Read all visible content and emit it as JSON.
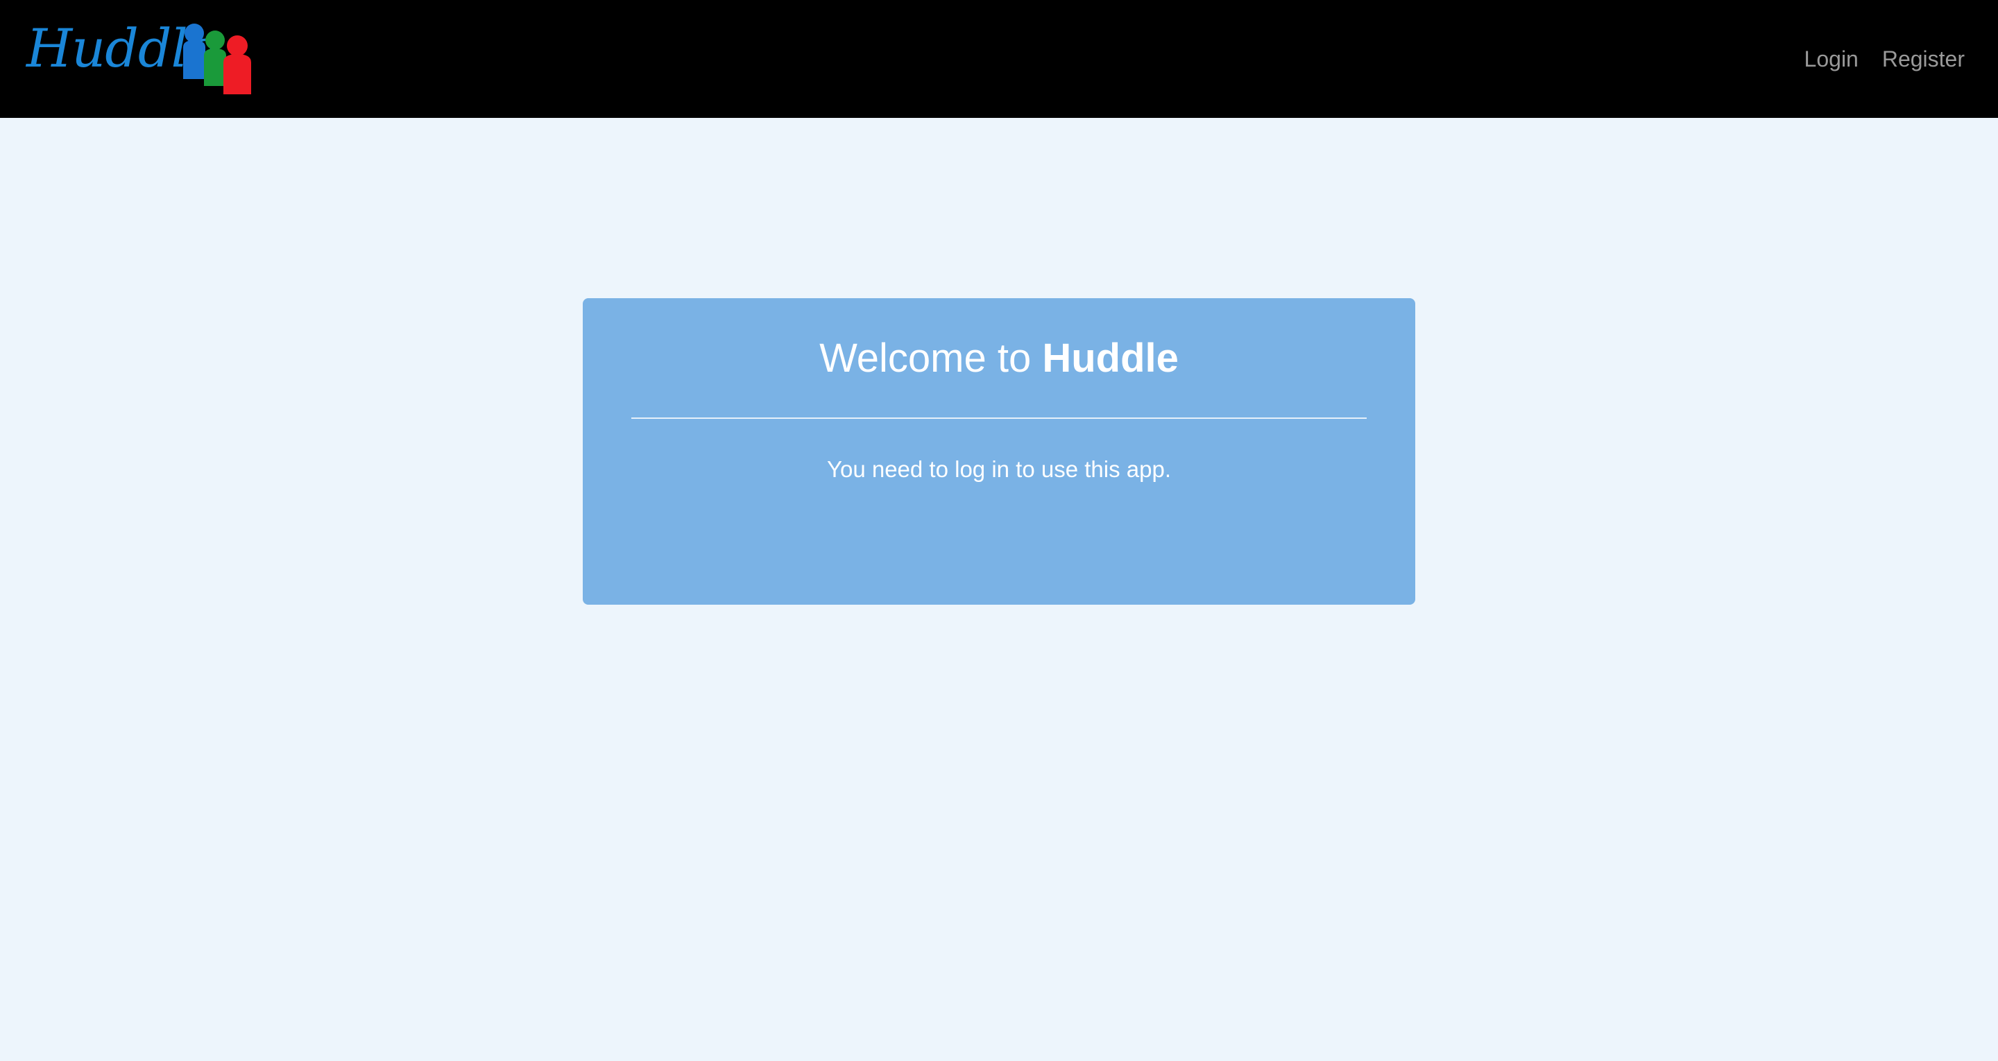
{
  "brand": {
    "name": "Huddle",
    "colors": {
      "text": "#1a86d8",
      "figure_blue": "#1a74d0",
      "figure_green": "#1a9a3a",
      "figure_red": "#ee1c25"
    }
  },
  "nav": {
    "login": "Login",
    "register": "Register"
  },
  "card": {
    "title_prefix": "Welcome to",
    "title_strong": "Huddle",
    "message": "You need to log in to use this app."
  },
  "colors": {
    "navbar_bg": "#000000",
    "page_bg": "#edf5fc",
    "card_bg": "#7ab2e5",
    "nav_link": "#9a9a9a"
  }
}
